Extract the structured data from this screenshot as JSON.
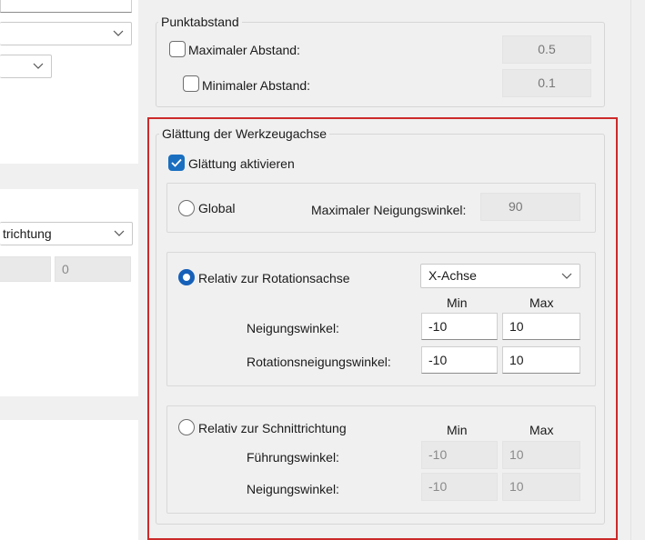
{
  "left_panel": {
    "combo1_value": "",
    "combo2_value": "",
    "combo3_value": "trichtung",
    "field_value": "0"
  },
  "punktabstand": {
    "title": "Punktabstand",
    "max_label": "Maximaler Abstand:",
    "max_value": "0.5",
    "max_checked": false,
    "min_label": "Minimaler Abstand:",
    "min_value": "0.1",
    "min_checked": false
  },
  "smoothing": {
    "title": "Glättung der Werkzeugachse",
    "enable_label": "Glättung aktivieren",
    "enable_checked": true,
    "global": {
      "label": "Global",
      "selected": false,
      "max_tilt_label": "Maximaler Neigungswinkel:",
      "max_tilt_value": "90"
    },
    "rotation": {
      "label": "Relativ zur Rotationsachse",
      "selected": true,
      "axis_value": "X-Achse",
      "min_header": "Min",
      "max_header": "Max",
      "tilt_label": "Neigungswinkel:",
      "tilt_min": "-10",
      "tilt_max": "10",
      "rot_tilt_label": "Rotationsneigungswinkel:",
      "rot_tilt_min": "-10",
      "rot_tilt_max": "10"
    },
    "cut_direction": {
      "label": "Relativ zur Schnittrichtung",
      "selected": false,
      "min_header": "Min",
      "max_header": "Max",
      "lead_label": "Führungswinkel:",
      "lead_min": "-10",
      "lead_max": "10",
      "tilt_label": "Neigungswinkel:",
      "tilt_min": "-10",
      "tilt_max": "10"
    }
  },
  "colors": {
    "accent": "#1a6fc0",
    "highlight": "#cc2a2a"
  }
}
